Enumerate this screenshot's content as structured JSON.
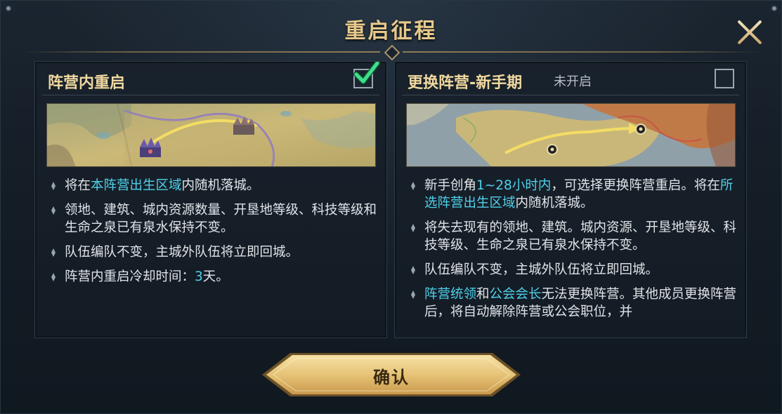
{
  "dialog": {
    "title": "重启征程",
    "confirm_label": "确认"
  },
  "left_panel": {
    "title": "阵营内重启",
    "checked": true,
    "bullets": [
      [
        "将在",
        "本阵营出生区域",
        "内随机落城。"
      ],
      [
        "领地、建筑、城内资源数量、开垦地等级、科技等级和生命之泉已有泉水保持不变。",
        "",
        ""
      ],
      [
        "队伍编队不变，主城外队伍将立即回城。",
        "",
        ""
      ],
      [
        "阵营内重启冷却时间：",
        "3",
        "天。"
      ]
    ]
  },
  "right_panel": {
    "title": "更换阵营-新手期",
    "status": "未开启",
    "checked": false,
    "bullet1": [
      "新手创角",
      "1~28小时内",
      "，可选择更换阵营重启。将在",
      "所选阵营出生区域",
      "内随机落城。"
    ],
    "bullet2": "将失去现有的领地、建筑。城内资源、开垦地等级、科技等级、生命之泉已有泉水保持不变。",
    "bullet3": "队伍编队不变，主城外队伍将立即回城。",
    "bullet4": [
      "阵营统领",
      "和",
      "公会会长",
      "无法更换阵营。其他成员更换阵营后，将自动解除阵营或公会职位，并"
    ]
  },
  "colors": {
    "highlight": "#4fd0ea",
    "title_gold": "#e7c98b",
    "check_green": "#3fe08a"
  },
  "icons": [
    "close-icon",
    "checkmark-icon",
    "bullet-diamond-icon"
  ]
}
